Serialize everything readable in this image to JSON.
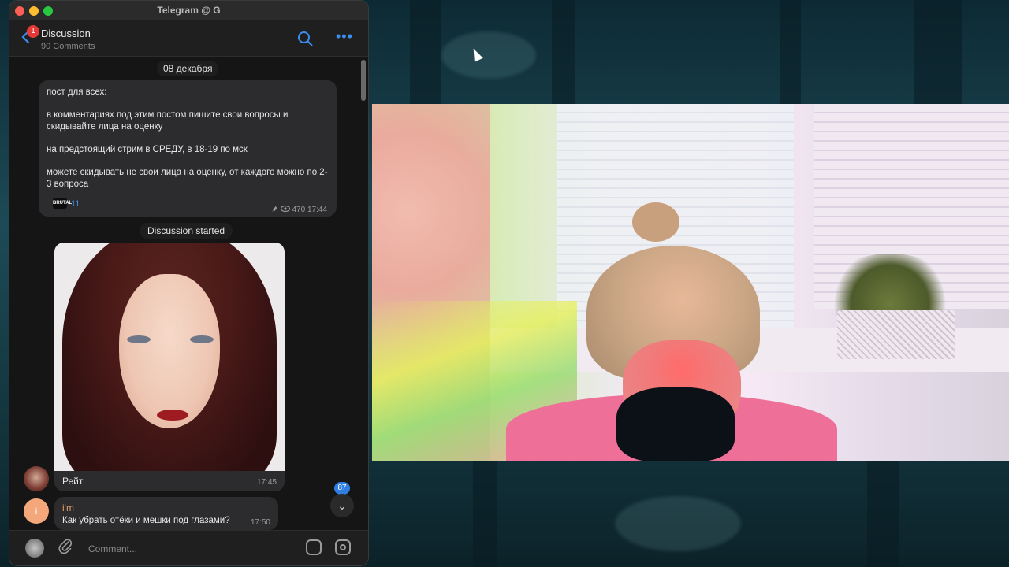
{
  "window": {
    "title": "Telegram @ G"
  },
  "header": {
    "back_badge": "1",
    "title": "Discussion",
    "subtitle": "90 Comments",
    "more_glyph": "•••"
  },
  "chat": {
    "date_separator": "08 декабря",
    "post": {
      "paragraphs": [
        "пост для всех:",
        "в комментариях под этим постом пишите свои вопросы и скидывайте лица на оценку",
        "на предстоящий стрим в СРЕДУ, в 18-19 по мск",
        "можете скидывать не свои лица на оценку, от каждого можно по 2-3 вопроса"
      ],
      "reaction_label": "BRUTAL",
      "reaction_count": "11",
      "meta": "470 17:44"
    },
    "discussion_started": "Discussion started",
    "photo_message": {
      "caption": "Рейт",
      "time": "17:45"
    },
    "message2": {
      "author": "i'm",
      "avatar_initial": "i",
      "text": "Как убрать отёки и мешки под глазами?",
      "time": "17:50"
    },
    "unread_count": "87",
    "scroll_down_glyph": "⌄"
  },
  "composer": {
    "placeholder": "Comment...",
    "attach_glyph": "📎"
  },
  "icons": [
    "back-chevron-icon",
    "search-icon",
    "more-icon",
    "pin-icon",
    "eye-icon",
    "attach-icon",
    "sticker-icon",
    "camera-icon",
    "chevron-down-icon"
  ],
  "colors": {
    "accent": "#3b8ef0",
    "bubble": "#2c2c2e",
    "badge_red": "#e53935",
    "author_orange": "#e39a5e"
  }
}
